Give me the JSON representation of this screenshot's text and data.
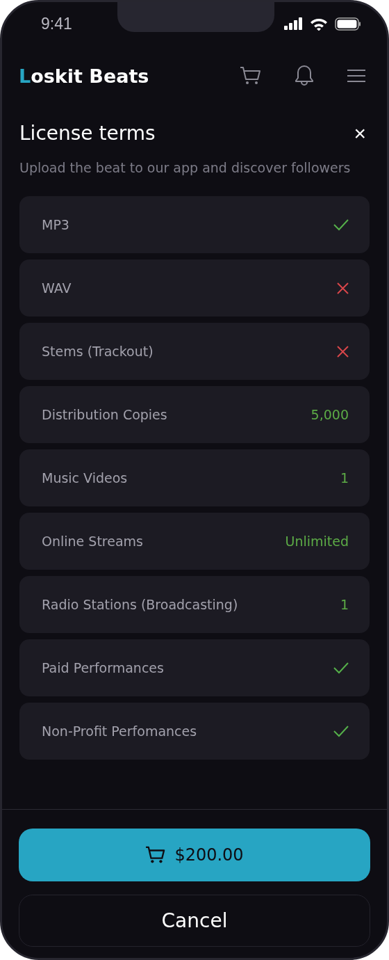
{
  "status_bar": {
    "time": "9:41"
  },
  "header": {
    "logo": "Loskit Beats"
  },
  "sheet": {
    "title": "License terms",
    "close": "×",
    "subtitle": "Upload the beat to our app and discover followers"
  },
  "terms": [
    {
      "label": "MP3",
      "kind": "mark",
      "included": true
    },
    {
      "label": "WAV",
      "kind": "mark",
      "included": false
    },
    {
      "label": "Stems (Trackout)",
      "kind": "mark",
      "included": false
    },
    {
      "label": "Distribution Copies",
      "kind": "value",
      "value": "5,000"
    },
    {
      "label": "Music Videos",
      "kind": "value",
      "value": "1"
    },
    {
      "label": "Online Streams",
      "kind": "value",
      "value": "Unlimited"
    },
    {
      "label": "Radio Stations (Broadcasting)",
      "kind": "value",
      "value": "1"
    },
    {
      "label": "Paid Performances",
      "kind": "mark",
      "included": true
    },
    {
      "label": "Non-Profit Perfomances",
      "kind": "mark",
      "included": true
    }
  ],
  "buttons": {
    "buy": "$200.00",
    "cancel": "Cancel"
  }
}
